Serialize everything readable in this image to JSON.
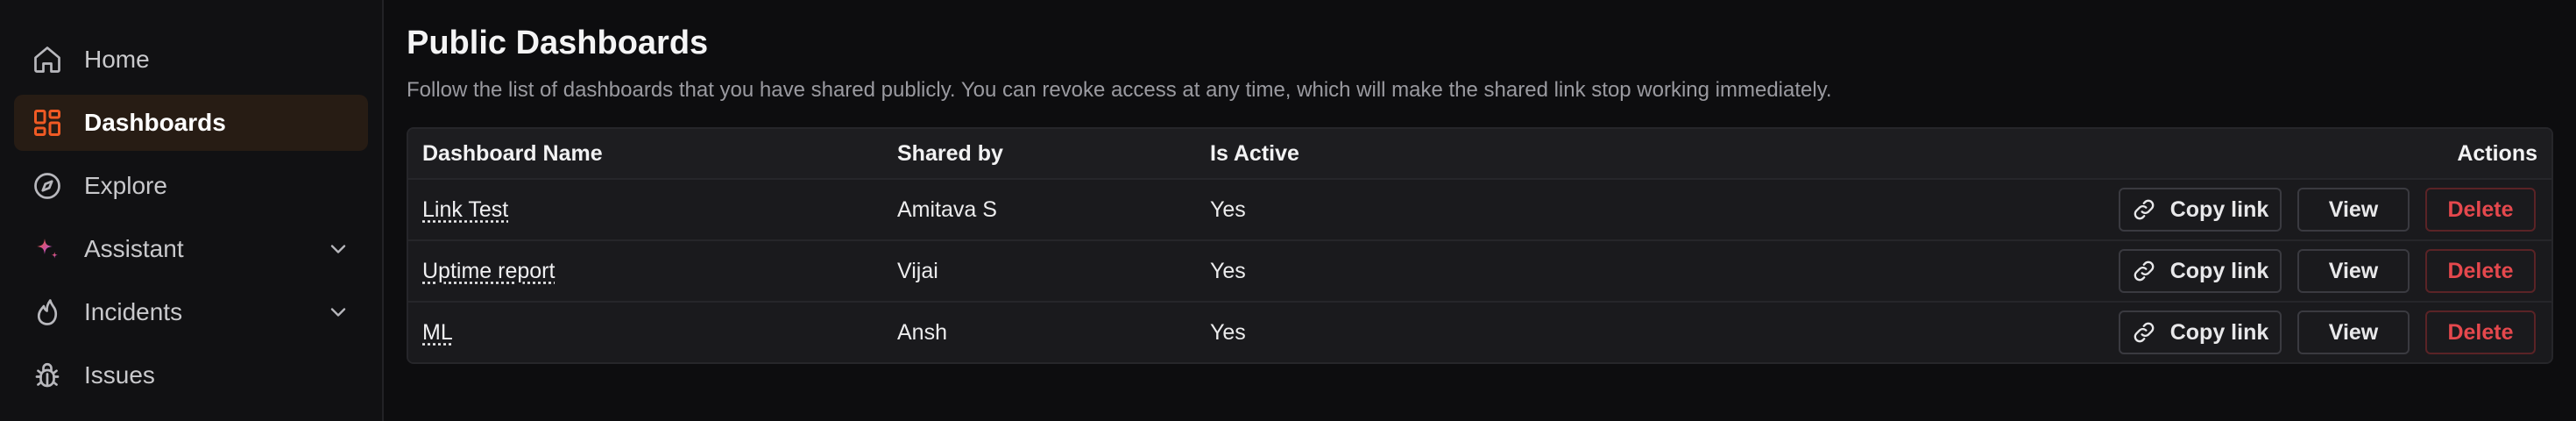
{
  "sidebar": {
    "items": [
      {
        "label": "Home",
        "icon": "home-icon",
        "active": false,
        "expandable": false
      },
      {
        "label": "Dashboards",
        "icon": "dashboards-icon",
        "active": true,
        "expandable": false
      },
      {
        "label": "Explore",
        "icon": "compass-icon",
        "active": false,
        "expandable": false
      },
      {
        "label": "Assistant",
        "icon": "sparkle-icon",
        "active": false,
        "expandable": true
      },
      {
        "label": "Incidents",
        "icon": "flame-icon",
        "active": false,
        "expandable": true
      },
      {
        "label": "Issues",
        "icon": "bug-icon",
        "active": false,
        "expandable": false
      }
    ]
  },
  "page": {
    "title": "Public Dashboards",
    "description": "Follow the list of dashboards that you have shared publicly. You can revoke access at any time, which will make the shared link stop working immediately."
  },
  "table": {
    "headers": {
      "name": "Dashboard Name",
      "shared_by": "Shared by",
      "is_active": "Is Active",
      "actions": "Actions"
    },
    "rows": [
      {
        "name": "Link Test",
        "shared_by": "Amitava S",
        "is_active": "Yes"
      },
      {
        "name": "Uptime report",
        "shared_by": "Vijai",
        "is_active": "Yes"
      },
      {
        "name": "ML",
        "shared_by": "Ansh",
        "is_active": "Yes"
      }
    ],
    "actions": {
      "copy_label": "Copy link",
      "view_label": "View",
      "delete_label": "Delete"
    }
  },
  "colors": {
    "accent": "#f05a24",
    "active_bg": "#271c14",
    "danger": "#e5484d",
    "assistant_gradient": [
      "#f05a24",
      "#b04cf0"
    ]
  }
}
